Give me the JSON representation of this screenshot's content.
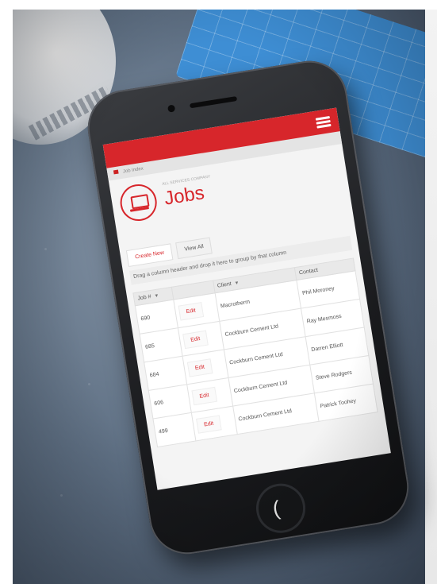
{
  "app": {
    "title": "Jobs",
    "subtitle": "ALL SERVICES COMPANY",
    "breadcrumb": "Job Index"
  },
  "tabs": [
    {
      "label": "Create New"
    },
    {
      "label": "View All"
    }
  ],
  "group_hint": "Drag a column header and drop it here to group by that column",
  "table": {
    "headers": [
      "Job #",
      "",
      "Client",
      "Contact"
    ],
    "rows": [
      {
        "job": "690",
        "action": "Edit",
        "client": "Macrotherm",
        "contact": "Phil Moroney"
      },
      {
        "job": "685",
        "action": "Edit",
        "client": "Cockburn Cement Ltd",
        "contact": "Ray Mesmoss"
      },
      {
        "job": "684",
        "action": "Edit",
        "client": "Cockburn Cement Ltd",
        "contact": "Darren Elliott"
      },
      {
        "job": "606",
        "action": "Edit",
        "client": "Cockburn Cement Ltd",
        "contact": "Steve Rodgers"
      },
      {
        "job": "499",
        "action": "Edit",
        "client": "Cockburn Cement Ltd",
        "contact": "Patrick Toohey"
      }
    ]
  },
  "colors": {
    "brand_red": "#d7262b",
    "blueprint_blue": "#3e8ed4"
  },
  "icons": [
    "menu-icon",
    "home-icon",
    "laptop-icon",
    "filter-icon",
    "chevron-down-icon"
  ]
}
